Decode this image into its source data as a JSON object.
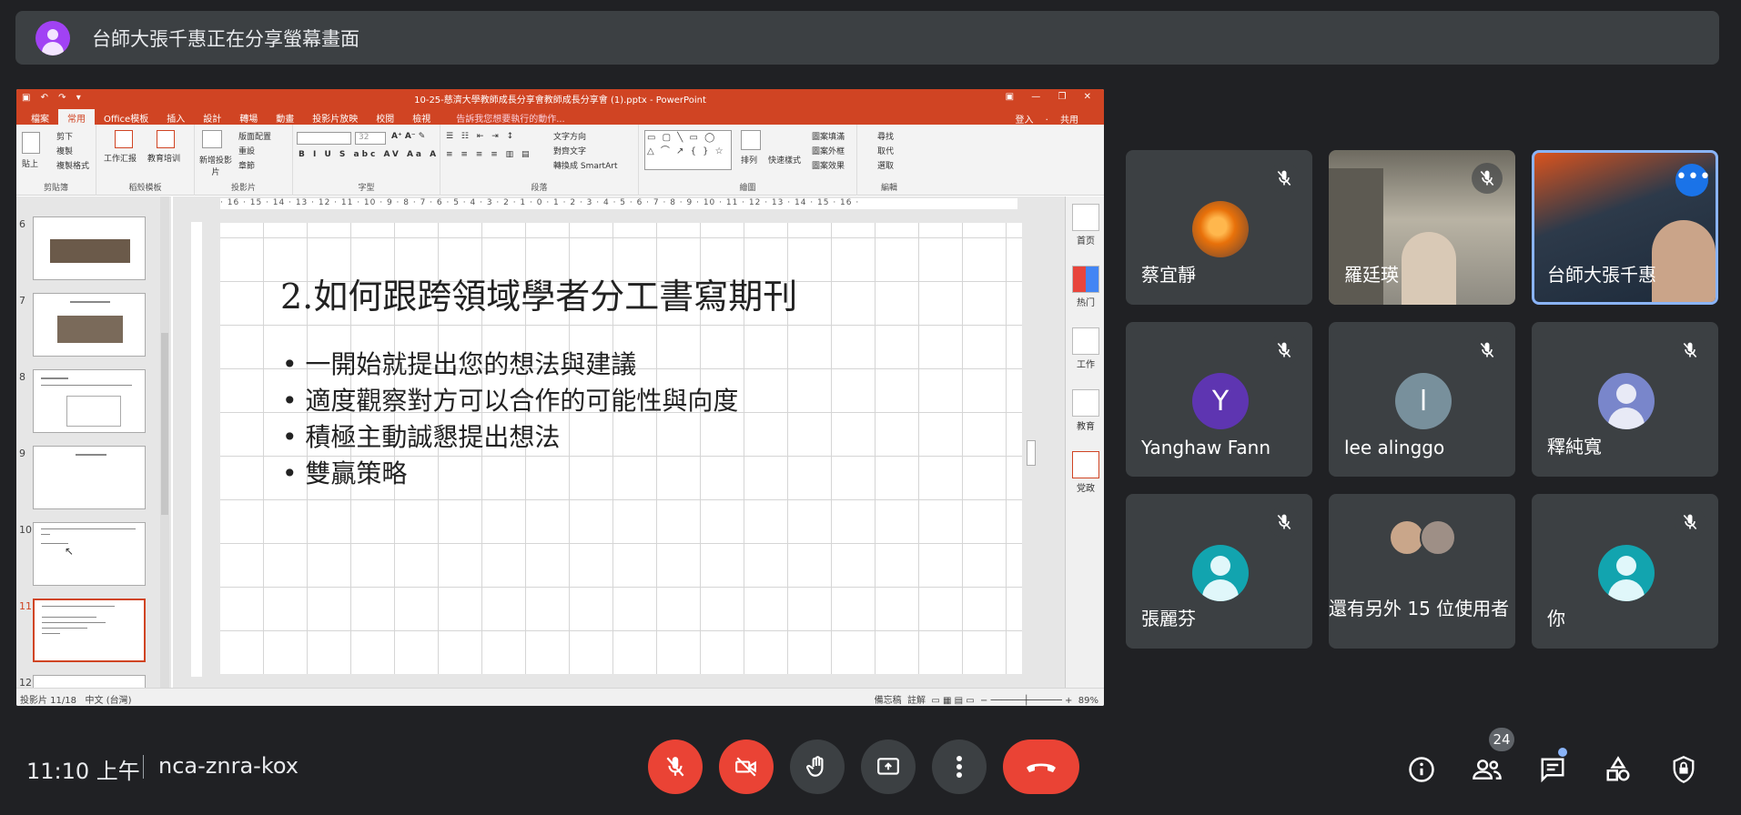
{
  "banner": {
    "text": "台師大張千惠正在分享螢幕畫面",
    "avatar_icon": "person-icon",
    "avatar_color": "#a142f4"
  },
  "ppt": {
    "window_title": "10-25-慈濟大學教師成長分享會教師成長分享會 (1).pptx - PowerPoint",
    "tabs": [
      "檔案",
      "常用",
      "Office模板",
      "插入",
      "設計",
      "轉場",
      "動畫",
      "投影片放映",
      "校閱",
      "檢視"
    ],
    "tell_me": "告訴我您想要執行的動作...",
    "sign_in": "登入",
    "share": "共用",
    "ribbon_groups": [
      "剪貼簿",
      "稻殼模板",
      "投影片",
      "字型",
      "段落",
      "繪圖",
      "編輯"
    ],
    "ribbon_items": {
      "cut": "剪下",
      "copy": "複製",
      "paste": "貼上",
      "format_painter": "複製格式",
      "work_report": "工作汇报",
      "edu_training": "教育培训",
      "new_slide": "新增投影片",
      "layout": "版面配置",
      "reset": "重設",
      "section": "章節",
      "font_size": "32",
      "text_direction": "文字方向",
      "align_text": "對齊文字",
      "smartart": "轉換成 SmartArt",
      "arrange": "排列",
      "quick_styles": "快速樣式",
      "shape_fill": "圖案填滿",
      "shape_outline": "圖案外框",
      "shape_effects": "圖案效果",
      "find": "尋找",
      "replace": "取代",
      "select": "選取"
    },
    "ruler_text": "· 16 · 15 · 14 · 13 · 12 · 11 · 10 · 9 · 8 · 7 · 6 · 5 · 4 · 3 · 2 · 1 · 0 · 1 · 2 · 3 · 4 · 5 · 6 · 7 · 8 · 9 · 10 · 11 · 12 · 13 · 14 · 15 · 16 ·",
    "thumbnails": [
      {
        "num": "6",
        "selected": false
      },
      {
        "num": "7",
        "selected": false
      },
      {
        "num": "8",
        "selected": false
      },
      {
        "num": "9",
        "selected": false
      },
      {
        "num": "10",
        "selected": false
      },
      {
        "num": "11",
        "selected": true
      },
      {
        "num": "12",
        "selected": false
      }
    ],
    "slide": {
      "title": "2.如何跟跨領域學者分工書寫期刊",
      "bullets": [
        "一開始就提出您的想法與建議",
        "適度觀察對方可以合作的可能性與向度",
        "積極主動誠懇提出想法",
        "雙贏策略"
      ]
    },
    "side_panel": [
      "首页",
      "热门",
      "工作",
      "教育",
      "党政"
    ],
    "status": {
      "slide_count": "投影片 11/18",
      "language": "中文 (台灣)",
      "notes": "備忘稿",
      "comments": "註解",
      "zoom": "89%"
    }
  },
  "participants": [
    {
      "name": "蔡宜靜",
      "muted": true,
      "avatar_type": "photo-flower",
      "avatar_color": "#e8710a"
    },
    {
      "name": "羅廷瑛",
      "muted": true,
      "avatar_type": "video",
      "avatar_color": "#8a8f86"
    },
    {
      "name": "台師大張千惠",
      "muted": false,
      "avatar_type": "video-autumn",
      "avatar_color": "#2d3a4a",
      "active": true
    },
    {
      "name": "Yanghaw Fann",
      "muted": true,
      "initial": "Y",
      "avatar_color": "#5e35b1"
    },
    {
      "name": "lee alinggo",
      "muted": true,
      "initial": "l",
      "avatar_color": "#78909c"
    },
    {
      "name": "釋純寬",
      "muted": true,
      "avatar_type": "person",
      "avatar_color": "#7986cb"
    },
    {
      "name": "張麗芬",
      "muted": true,
      "avatar_type": "person",
      "avatar_color": "#12a4af"
    },
    {
      "name": "還有另外 15 位使用者",
      "muted": false,
      "avatar_type": "group"
    },
    {
      "name": "你",
      "muted": true,
      "avatar_type": "person",
      "avatar_color": "#12a4af"
    }
  ],
  "meeting": {
    "time": "11:10 上午",
    "code": "nca-znra-kox",
    "participant_count": "24"
  },
  "controls": {
    "mic": "mic-off-icon",
    "camera": "camera-off-icon",
    "hand": "raise-hand-icon",
    "present": "present-screen-icon",
    "more": "more-options-icon",
    "leave": "leave-call-icon",
    "info": "info-icon",
    "people": "people-icon",
    "chat": "chat-icon",
    "activities": "activities-icon",
    "host": "host-controls-icon",
    "red": "#ea4335",
    "dark": "#3c4043"
  }
}
